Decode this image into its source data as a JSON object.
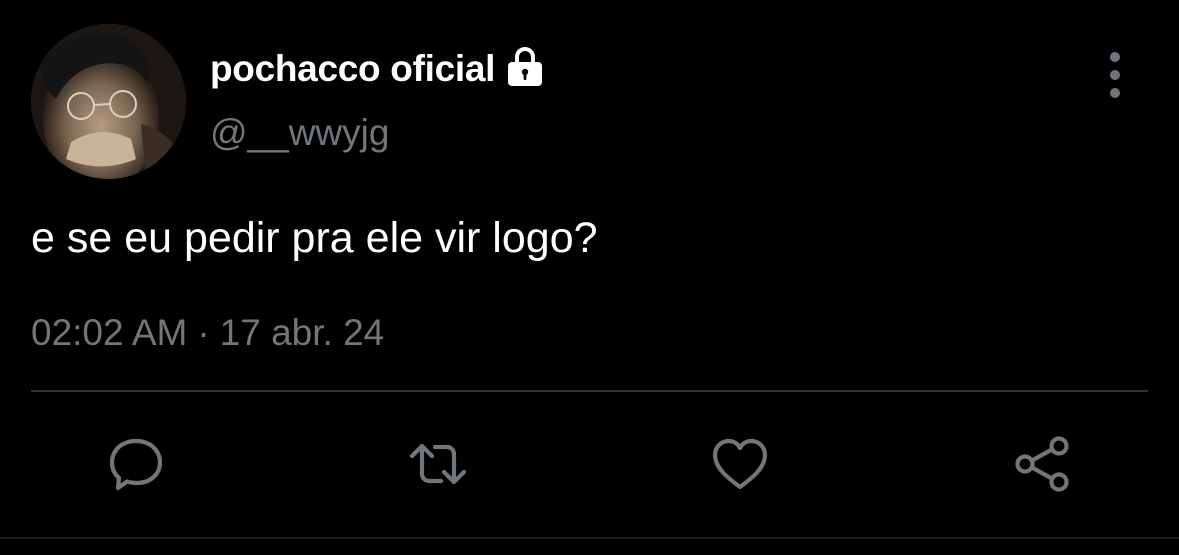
{
  "user": {
    "display_name": "pochacco oficial",
    "handle": "@__wwyjg",
    "protected_icon": "lock-icon",
    "avatar_icon": "profile-photo"
  },
  "tweet": {
    "text": "e se eu pedir pra ele vir logo?",
    "time": "02:02 AM",
    "separator": "·",
    "date": "17 abr. 24"
  },
  "actions": {
    "reply_icon": "reply-icon",
    "retweet_icon": "retweet-icon",
    "like_icon": "heart-icon",
    "share_icon": "share-icon",
    "more_icon": "more-vertical-icon"
  },
  "colors": {
    "background": "#000000",
    "primary_text": "#ffffff",
    "secondary_text": "#71767b",
    "divider": "#2f3336",
    "icon": "#71767b"
  }
}
